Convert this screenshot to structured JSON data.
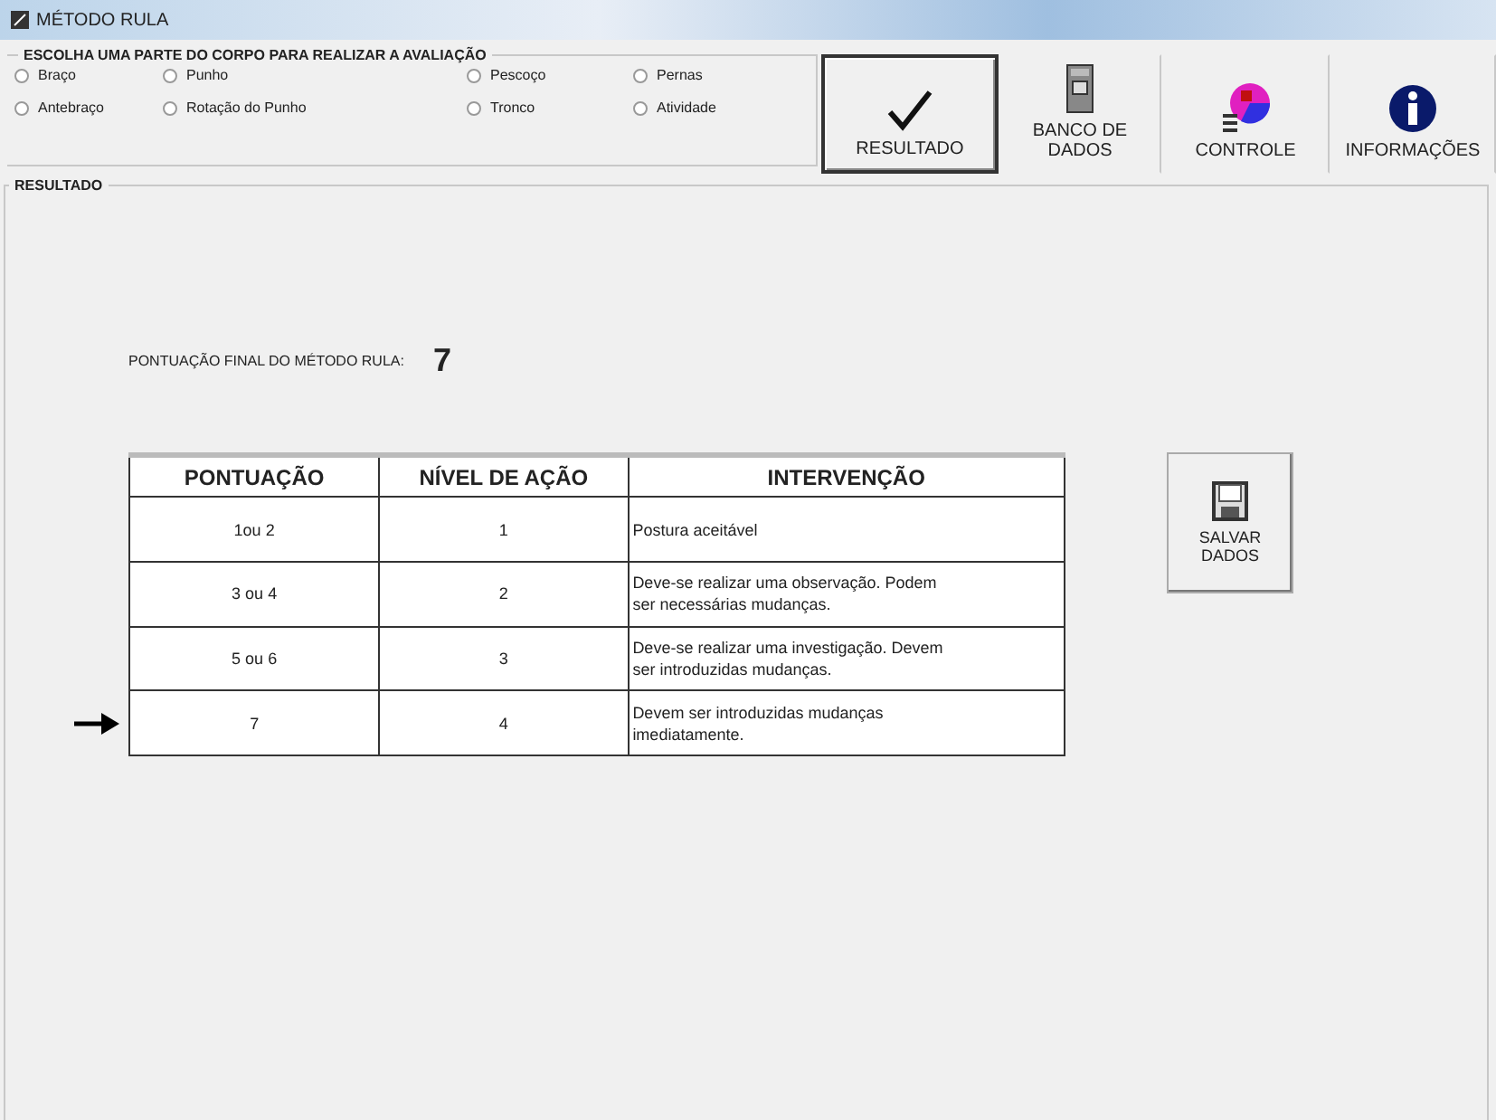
{
  "window": {
    "title": "MÉTODO RULA"
  },
  "body_part_group": {
    "title": "ESCOLHA UMA PARTE DO CORPO PARA REALIZAR A AVALIAÇÃO",
    "options": [
      {
        "label": "Braço",
        "checked": false
      },
      {
        "label": "Punho",
        "checked": false
      },
      {
        "label": "Pescoço",
        "checked": false
      },
      {
        "label": "Pernas",
        "checked": false
      },
      {
        "label": "Antebraço",
        "checked": false
      },
      {
        "label": "Rotação do Punho",
        "checked": false
      },
      {
        "label": "Tronco",
        "checked": false
      },
      {
        "label": "Atividade",
        "checked": false
      }
    ]
  },
  "toolbar": [
    {
      "kind": "check",
      "label": "RESULTADO",
      "selected": true
    },
    {
      "kind": "database",
      "label": "BANCO DE DADOS",
      "selected": false
    },
    {
      "kind": "control",
      "label": "CONTROLE",
      "selected": false
    },
    {
      "kind": "info",
      "label": "INFORMAÇÕES",
      "selected": false
    }
  ],
  "result_group": {
    "title": "RESULTADO",
    "score_label": "PONTUAÇÃO FINAL DO MÉTODO RULA:",
    "score": "7",
    "table": {
      "columns": [
        "PONTUAÇÃO",
        "NÍVEL DE AÇÃO",
        "INTERVENÇÃO"
      ],
      "rows": [
        {
          "cells": [
            "1ou 2",
            "1",
            "Postura aceitável"
          ],
          "selected": false
        },
        {
          "cells": [
            "3 ou 4",
            "2",
            "Deve-se realizar uma observação. Podem ser necessárias mudanças."
          ],
          "selected": false
        },
        {
          "cells": [
            "5 ou 6",
            "3",
            "Deve-se realizar uma investigação. Devem ser introduzidas mudanças."
          ],
          "selected": false
        },
        {
          "cells": [
            "7",
            "4",
            "Devem ser introduzidas mudanças imediatamente."
          ],
          "selected": true
        }
      ]
    },
    "save_button": {
      "label": "SALVAR DADOS"
    }
  }
}
